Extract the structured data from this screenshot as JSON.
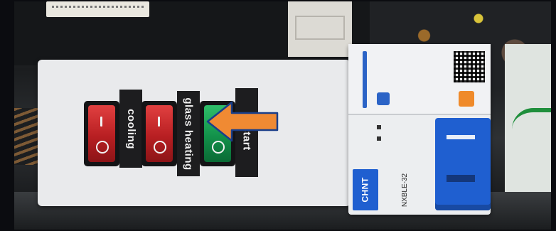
{
  "switch_panel": {
    "label_cooling": "cooling",
    "label_glass_heating": "glass heating",
    "label_restart": "restart"
  },
  "breaker": {
    "brand": "CHNT",
    "model": "NXBLE-32"
  },
  "colors": {
    "red_switch": "#c4272a",
    "green_switch": "#139a4d",
    "arrow": "#f08a33",
    "breaker_blue": "#1f5fd0"
  },
  "icons": {
    "arrow": "arrow-left-icon"
  }
}
